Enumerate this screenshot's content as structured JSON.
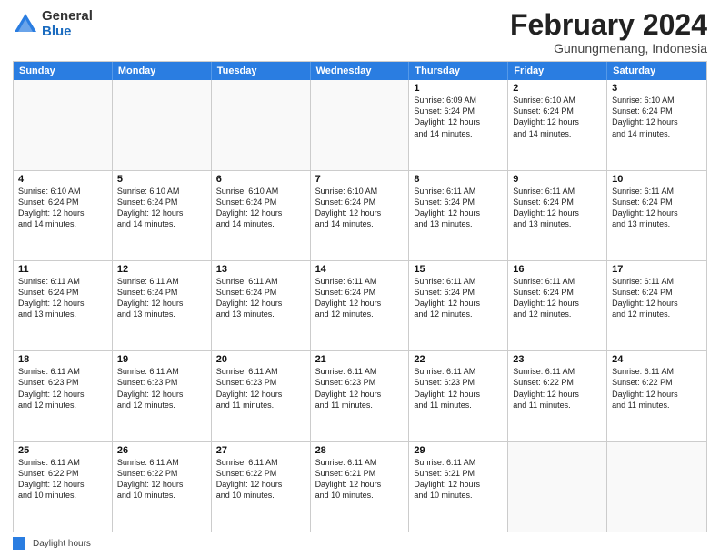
{
  "logo": {
    "general": "General",
    "blue": "Blue"
  },
  "title": {
    "month": "February 2024",
    "location": "Gunungmenang, Indonesia"
  },
  "header_days": [
    "Sunday",
    "Monday",
    "Tuesday",
    "Wednesday",
    "Thursday",
    "Friday",
    "Saturday"
  ],
  "weeks": [
    [
      {
        "day": "",
        "info": ""
      },
      {
        "day": "",
        "info": ""
      },
      {
        "day": "",
        "info": ""
      },
      {
        "day": "",
        "info": ""
      },
      {
        "day": "1",
        "info": "Sunrise: 6:09 AM\nSunset: 6:24 PM\nDaylight: 12 hours\nand 14 minutes."
      },
      {
        "day": "2",
        "info": "Sunrise: 6:10 AM\nSunset: 6:24 PM\nDaylight: 12 hours\nand 14 minutes."
      },
      {
        "day": "3",
        "info": "Sunrise: 6:10 AM\nSunset: 6:24 PM\nDaylight: 12 hours\nand 14 minutes."
      }
    ],
    [
      {
        "day": "4",
        "info": "Sunrise: 6:10 AM\nSunset: 6:24 PM\nDaylight: 12 hours\nand 14 minutes."
      },
      {
        "day": "5",
        "info": "Sunrise: 6:10 AM\nSunset: 6:24 PM\nDaylight: 12 hours\nand 14 minutes."
      },
      {
        "day": "6",
        "info": "Sunrise: 6:10 AM\nSunset: 6:24 PM\nDaylight: 12 hours\nand 14 minutes."
      },
      {
        "day": "7",
        "info": "Sunrise: 6:10 AM\nSunset: 6:24 PM\nDaylight: 12 hours\nand 14 minutes."
      },
      {
        "day": "8",
        "info": "Sunrise: 6:11 AM\nSunset: 6:24 PM\nDaylight: 12 hours\nand 13 minutes."
      },
      {
        "day": "9",
        "info": "Sunrise: 6:11 AM\nSunset: 6:24 PM\nDaylight: 12 hours\nand 13 minutes."
      },
      {
        "day": "10",
        "info": "Sunrise: 6:11 AM\nSunset: 6:24 PM\nDaylight: 12 hours\nand 13 minutes."
      }
    ],
    [
      {
        "day": "11",
        "info": "Sunrise: 6:11 AM\nSunset: 6:24 PM\nDaylight: 12 hours\nand 13 minutes."
      },
      {
        "day": "12",
        "info": "Sunrise: 6:11 AM\nSunset: 6:24 PM\nDaylight: 12 hours\nand 13 minutes."
      },
      {
        "day": "13",
        "info": "Sunrise: 6:11 AM\nSunset: 6:24 PM\nDaylight: 12 hours\nand 13 minutes."
      },
      {
        "day": "14",
        "info": "Sunrise: 6:11 AM\nSunset: 6:24 PM\nDaylight: 12 hours\nand 12 minutes."
      },
      {
        "day": "15",
        "info": "Sunrise: 6:11 AM\nSunset: 6:24 PM\nDaylight: 12 hours\nand 12 minutes."
      },
      {
        "day": "16",
        "info": "Sunrise: 6:11 AM\nSunset: 6:24 PM\nDaylight: 12 hours\nand 12 minutes."
      },
      {
        "day": "17",
        "info": "Sunrise: 6:11 AM\nSunset: 6:24 PM\nDaylight: 12 hours\nand 12 minutes."
      }
    ],
    [
      {
        "day": "18",
        "info": "Sunrise: 6:11 AM\nSunset: 6:23 PM\nDaylight: 12 hours\nand 12 minutes."
      },
      {
        "day": "19",
        "info": "Sunrise: 6:11 AM\nSunset: 6:23 PM\nDaylight: 12 hours\nand 12 minutes."
      },
      {
        "day": "20",
        "info": "Sunrise: 6:11 AM\nSunset: 6:23 PM\nDaylight: 12 hours\nand 11 minutes."
      },
      {
        "day": "21",
        "info": "Sunrise: 6:11 AM\nSunset: 6:23 PM\nDaylight: 12 hours\nand 11 minutes."
      },
      {
        "day": "22",
        "info": "Sunrise: 6:11 AM\nSunset: 6:23 PM\nDaylight: 12 hours\nand 11 minutes."
      },
      {
        "day": "23",
        "info": "Sunrise: 6:11 AM\nSunset: 6:22 PM\nDaylight: 12 hours\nand 11 minutes."
      },
      {
        "day": "24",
        "info": "Sunrise: 6:11 AM\nSunset: 6:22 PM\nDaylight: 12 hours\nand 11 minutes."
      }
    ],
    [
      {
        "day": "25",
        "info": "Sunrise: 6:11 AM\nSunset: 6:22 PM\nDaylight: 12 hours\nand 10 minutes."
      },
      {
        "day": "26",
        "info": "Sunrise: 6:11 AM\nSunset: 6:22 PM\nDaylight: 12 hours\nand 10 minutes."
      },
      {
        "day": "27",
        "info": "Sunrise: 6:11 AM\nSunset: 6:22 PM\nDaylight: 12 hours\nand 10 minutes."
      },
      {
        "day": "28",
        "info": "Sunrise: 6:11 AM\nSunset: 6:21 PM\nDaylight: 12 hours\nand 10 minutes."
      },
      {
        "day": "29",
        "info": "Sunrise: 6:11 AM\nSunset: 6:21 PM\nDaylight: 12 hours\nand 10 minutes."
      },
      {
        "day": "",
        "info": ""
      },
      {
        "day": "",
        "info": ""
      }
    ]
  ],
  "footer": {
    "legend_label": "Daylight hours"
  }
}
